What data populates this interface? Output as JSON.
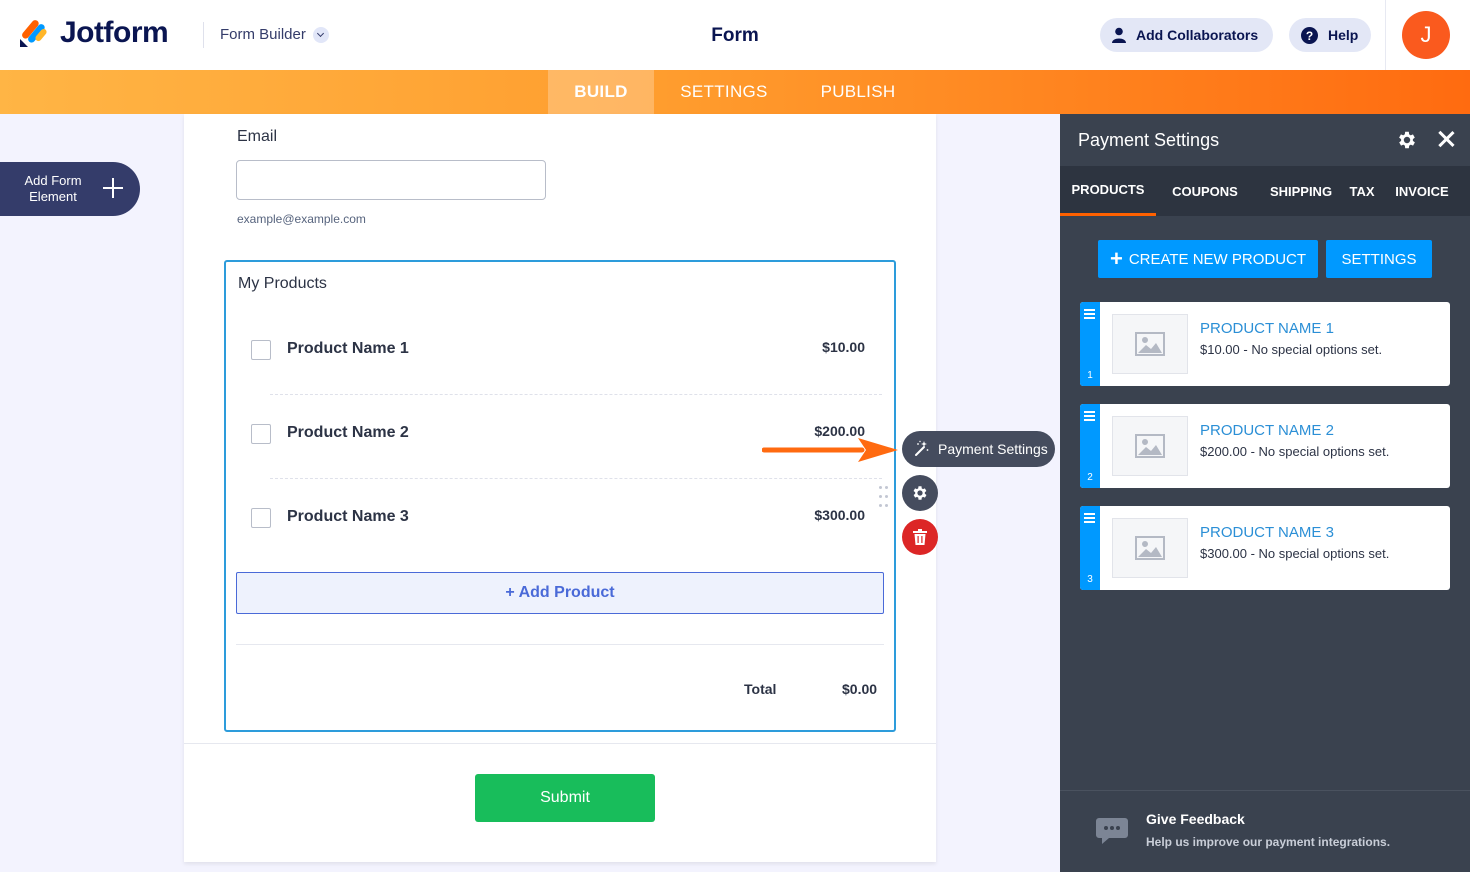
{
  "header": {
    "logo_text": "Jotform",
    "builder_menu": "Form Builder",
    "form_title": "Form",
    "add_collaborators": "Add Collaborators",
    "help": "Help",
    "avatar_initial": "J"
  },
  "tabs": {
    "build": "BUILD",
    "settings": "SETTINGS",
    "publish": "PUBLISH"
  },
  "sidebar": {
    "add_form_element": "Add Form Element"
  },
  "form": {
    "email_label": "Email",
    "email_value": "",
    "email_hint": "example@example.com",
    "products_title": "My Products",
    "products": [
      {
        "name": "Product Name 1",
        "price": "$10.00",
        "checked": false
      },
      {
        "name": "Product Name 2",
        "price": "$200.00",
        "checked": false
      },
      {
        "name": "Product Name 3",
        "price": "$300.00",
        "checked": false
      }
    ],
    "add_product": "+ Add Product",
    "total_label": "Total",
    "total_value": "$0.00",
    "submit": "Submit"
  },
  "floating_tools": {
    "payment_settings": "Payment Settings"
  },
  "payment_panel": {
    "title": "Payment Settings",
    "tabs": [
      "PRODUCTS",
      "COUPONS",
      "SHIPPING",
      "TAX",
      "INVOICE"
    ],
    "active_tab": "PRODUCTS",
    "create_new_product": "CREATE NEW PRODUCT",
    "settings_button": "SETTINGS",
    "products": [
      {
        "index": "1",
        "name": "PRODUCT NAME 1",
        "desc": "$10.00 - No special options set."
      },
      {
        "index": "2",
        "name": "PRODUCT NAME 2",
        "desc": "$200.00 - No special options set."
      },
      {
        "index": "3",
        "name": "PRODUCT NAME 3",
        "desc": "$300.00 - No special options set."
      }
    ],
    "feedback_title": "Give Feedback",
    "feedback_sub": "Help us improve our payment integrations."
  },
  "colors": {
    "brand_navy": "#0a1551",
    "accent_orange": "#ff6100",
    "panel_bg": "#3a424f",
    "primary_blue": "#0099ff",
    "submit_green": "#18bd5b",
    "delete_red": "#dc2626"
  }
}
